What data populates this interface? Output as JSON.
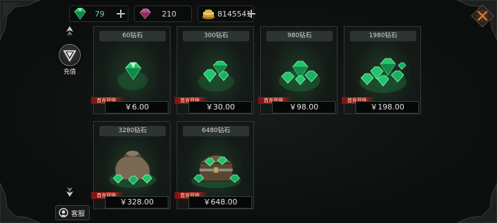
{
  "currency": {
    "diamond": "79",
    "pink_gem": "210",
    "gold": "8145541"
  },
  "nav": {
    "recharge_label": "充值",
    "service_label": "客服"
  },
  "products": [
    {
      "title": "60钻石",
      "badge": "首充双倍",
      "price": "￥6.00",
      "art": "diamond-1"
    },
    {
      "title": "300钻石",
      "badge": "首充双倍",
      "price": "￥30.00",
      "art": "diamond-2"
    },
    {
      "title": "980钻石",
      "badge": "首充双倍",
      "price": "￥98.00",
      "art": "diamond-3"
    },
    {
      "title": "1980钻石",
      "badge": "首充双倍",
      "price": "￥198.00",
      "art": "diamond-4"
    },
    {
      "title": "3280钻石",
      "badge": "首充双倍",
      "price": "￥328.00",
      "art": "diamond-bag"
    },
    {
      "title": "6480钻石",
      "badge": "首充双倍",
      "price": "￥648.00",
      "art": "diamond-chest"
    }
  ],
  "colors": {
    "emerald": "#2ee07a",
    "badge_red": "#a5211a",
    "diamond_value": "#6fd0d6"
  }
}
